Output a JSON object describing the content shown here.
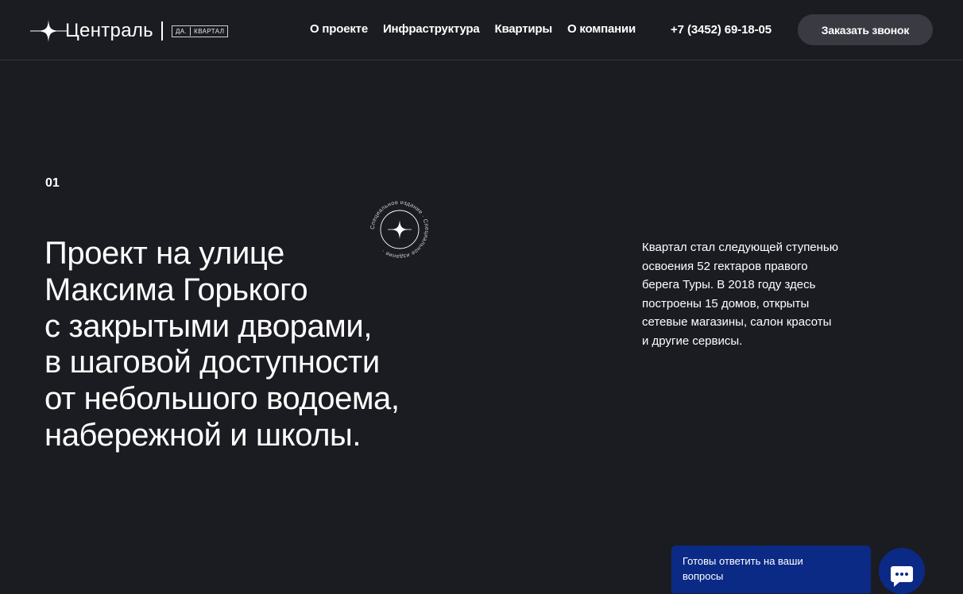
{
  "header": {
    "logo": {
      "name": "Централь",
      "badge_left": "ДА.",
      "badge_right": "КВАРТАЛ"
    },
    "nav": [
      {
        "label": "О проекте"
      },
      {
        "label": "Инфраструктура"
      },
      {
        "label": "Квартиры"
      },
      {
        "label": "О компании"
      }
    ],
    "phone": "+7 (3452) 69-18-05",
    "callback_button": "Заказать звонок"
  },
  "main": {
    "section_number": "01",
    "headline_lines": [
      "Проект на улице",
      "Максима Горького",
      "с закрытыми дворами,",
      "в шаговой доступности",
      "от небольшого водоема,",
      "набережной и школы."
    ],
    "stamp_text": "Специальное издание · Специальное издание ·",
    "description_lines": [
      "Квартал стал следующей ступенью",
      "освоения 52 гектаров правого",
      "берега Туры. В 2018 году здесь",
      "построены 15 домов, открыты",
      "сетевые магазины, салон красоты",
      "и другие сервисы."
    ]
  },
  "chat": {
    "message_lines": [
      "Готовы ответить на ваши",
      "вопросы"
    ],
    "button_icon": "chat-icon"
  },
  "colors": {
    "background": "#1b1c22",
    "button": "#3a3b42",
    "chat": "#0b2a86",
    "text": "#ffffff"
  }
}
